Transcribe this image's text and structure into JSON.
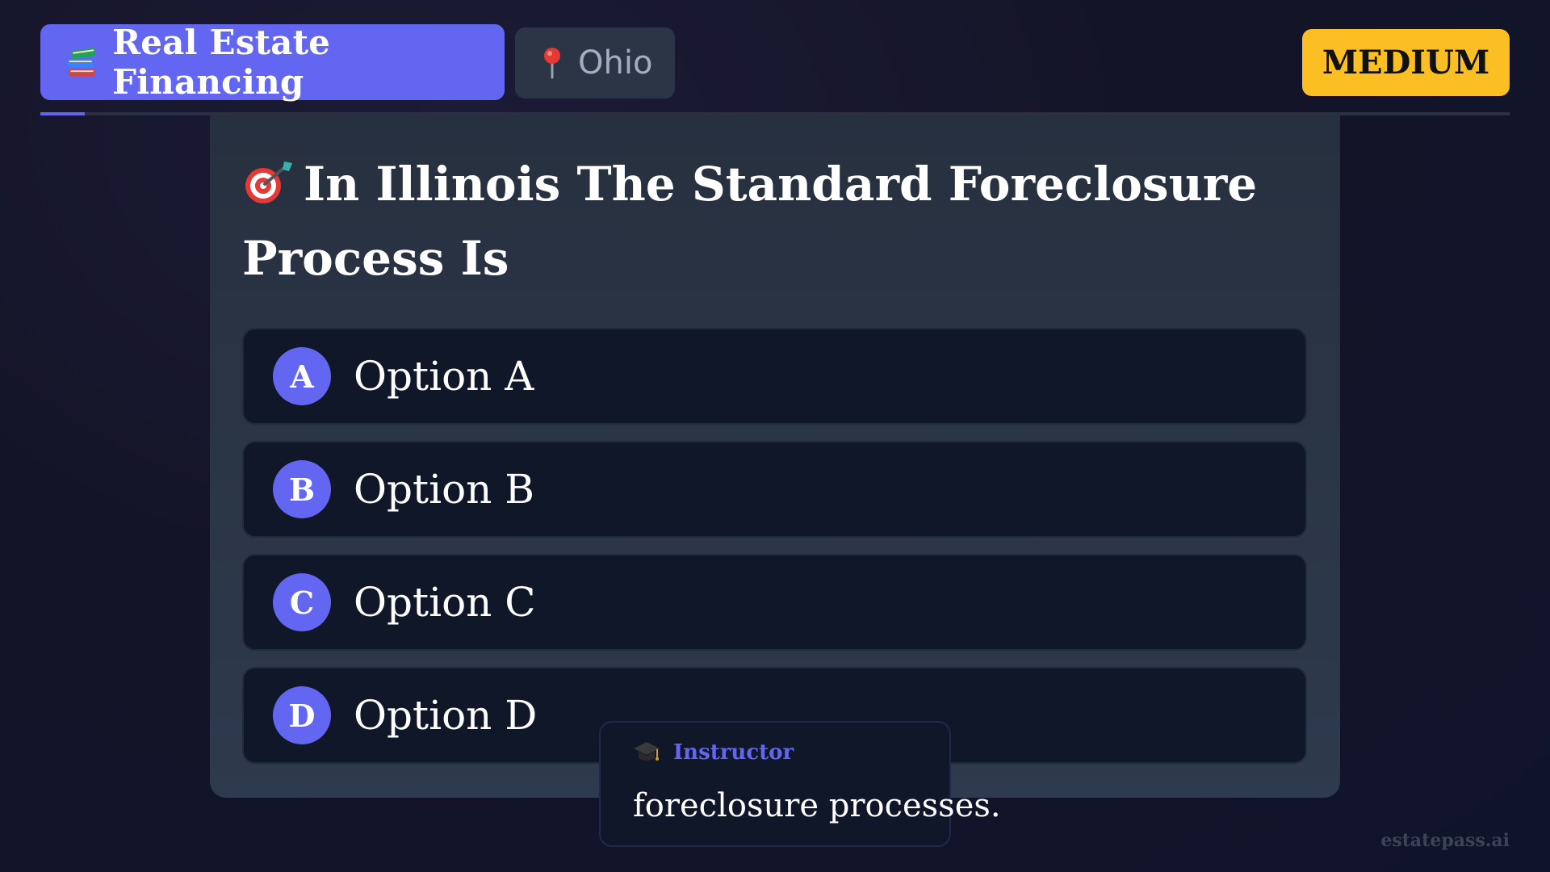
{
  "header": {
    "topic_label": "Real Estate Financing",
    "topic_icon": "books-icon",
    "state_label": "Ohio",
    "state_icon": "location-pin-icon",
    "difficulty": "MEDIUM"
  },
  "progress": {
    "fraction": 0.03
  },
  "question": {
    "icon": "target-icon",
    "text": "In Illinois The Standard Foreclosure Process Is"
  },
  "options": [
    {
      "letter": "A",
      "text": "Option A"
    },
    {
      "letter": "B",
      "text": "Option B"
    },
    {
      "letter": "C",
      "text": "Option C"
    },
    {
      "letter": "D",
      "text": "Option D"
    }
  ],
  "instructor": {
    "icon": "graduation-cap-icon",
    "name": "Instructor",
    "message": "foreclosure processes."
  },
  "watermark": "estatepass.ai",
  "colors": {
    "accent": "#6366f1",
    "difficulty_badge": "#fbbf24",
    "card": "#27303f",
    "option_bg": "#0f1729"
  }
}
